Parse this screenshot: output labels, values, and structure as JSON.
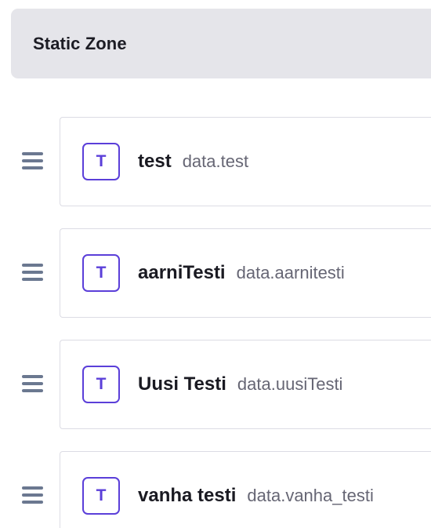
{
  "zone": {
    "title": "Static Zone"
  },
  "fields": [
    {
      "icon_letter": "T",
      "icon": "text-type-icon",
      "name": "test",
      "path": "data.test"
    },
    {
      "icon_letter": "T",
      "icon": "text-type-icon",
      "name": "aarniTesti",
      "path": "data.aarnitesti"
    },
    {
      "icon_letter": "T",
      "icon": "text-type-icon",
      "name": "Uusi Testi",
      "path": "data.uusiTesti"
    },
    {
      "icon_letter": "T",
      "icon": "text-type-icon",
      "name": "vanha testi",
      "path": "data.vanha_testi"
    }
  ],
  "colors": {
    "accent": "#5b3fd9",
    "header_bg": "#e5e5ea",
    "handle": "#6b7890",
    "border": "#dcdce4"
  }
}
